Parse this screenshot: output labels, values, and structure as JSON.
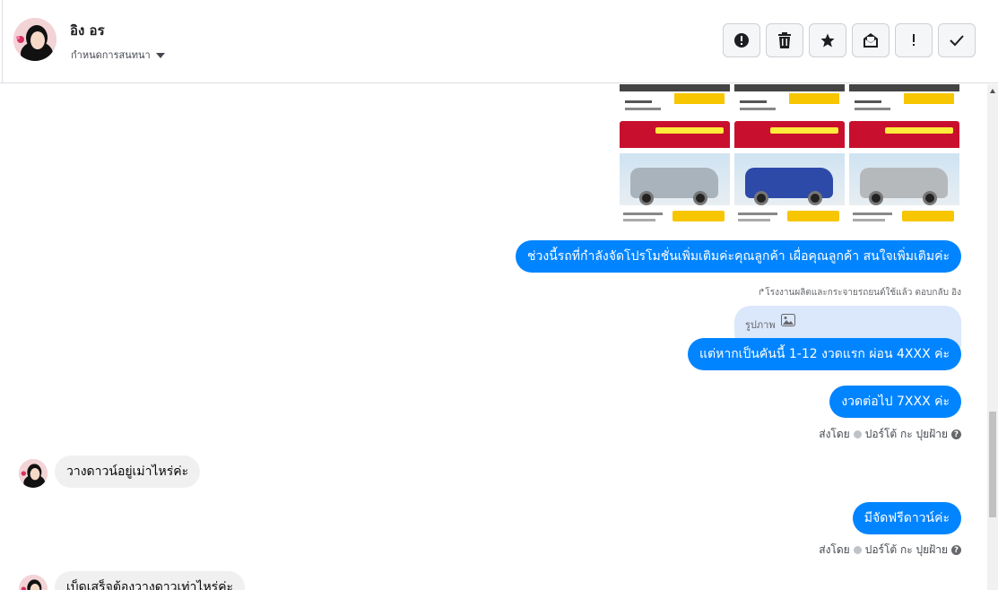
{
  "header": {
    "contact_name": "อิง อร",
    "assign_label": "กำหนดการสนทนา",
    "toolbar": {
      "spam_icon": "alert-circle-icon",
      "delete_icon": "trash-icon",
      "star_icon": "star-icon",
      "unread_icon": "mail-unread-icon",
      "follow_up_icon": "exclamation-icon",
      "done_icon": "check-icon"
    }
  },
  "messages": [
    {
      "id": "m1",
      "direction": "out",
      "text": "ช่วงนี้รถที่กำลังจัดโปรโมชั่นเพิ่มเติมค่ะคุณลูกค้า เผื่อคุณลูกค้า สนใจเพิ่มเติมค่ะ"
    },
    {
      "id": "m2",
      "direction": "out",
      "reply_note": "โรงงานผลิตและกระจายรถยนต์ใช้แล้ว ตอบกลับ อิง",
      "quoted": "รูปภาพ",
      "text": "แต่หากเป็นคันนี้ 1-12 งวดแรก ผ่อน 4XXX  ค่ะ"
    },
    {
      "id": "m3",
      "direction": "out",
      "text": "งวดต่อไป 7XXX ค่ะ",
      "sent_by": "ส่งโดย",
      "sender": "ปอร์โต้ กะ ปุยฝ้าย"
    },
    {
      "id": "m4",
      "direction": "in",
      "text": "วางดาวน์อยู่เม่าไหร่ค่ะ"
    },
    {
      "id": "m5",
      "direction": "out",
      "text": "มีจัดฟรีดาวน์ค่ะ",
      "sent_by": "ส่งโดย",
      "sender": "ปอร์โต้ กะ ปุยฝ้าย"
    },
    {
      "id": "m6",
      "direction": "in",
      "text": "เบ็ดเสร็จต้องวางดาวเท่าไหร่ค่ะ"
    }
  ],
  "colors": {
    "outgoing": "#0084ff",
    "incoming": "#f0f0f0",
    "reply_quote": "#dbe7fb"
  },
  "images": [
    {
      "car_color": "#a9b3bb"
    },
    {
      "car_color": "#2d4aa8"
    },
    {
      "car_color": "#b6b9bc"
    }
  ]
}
